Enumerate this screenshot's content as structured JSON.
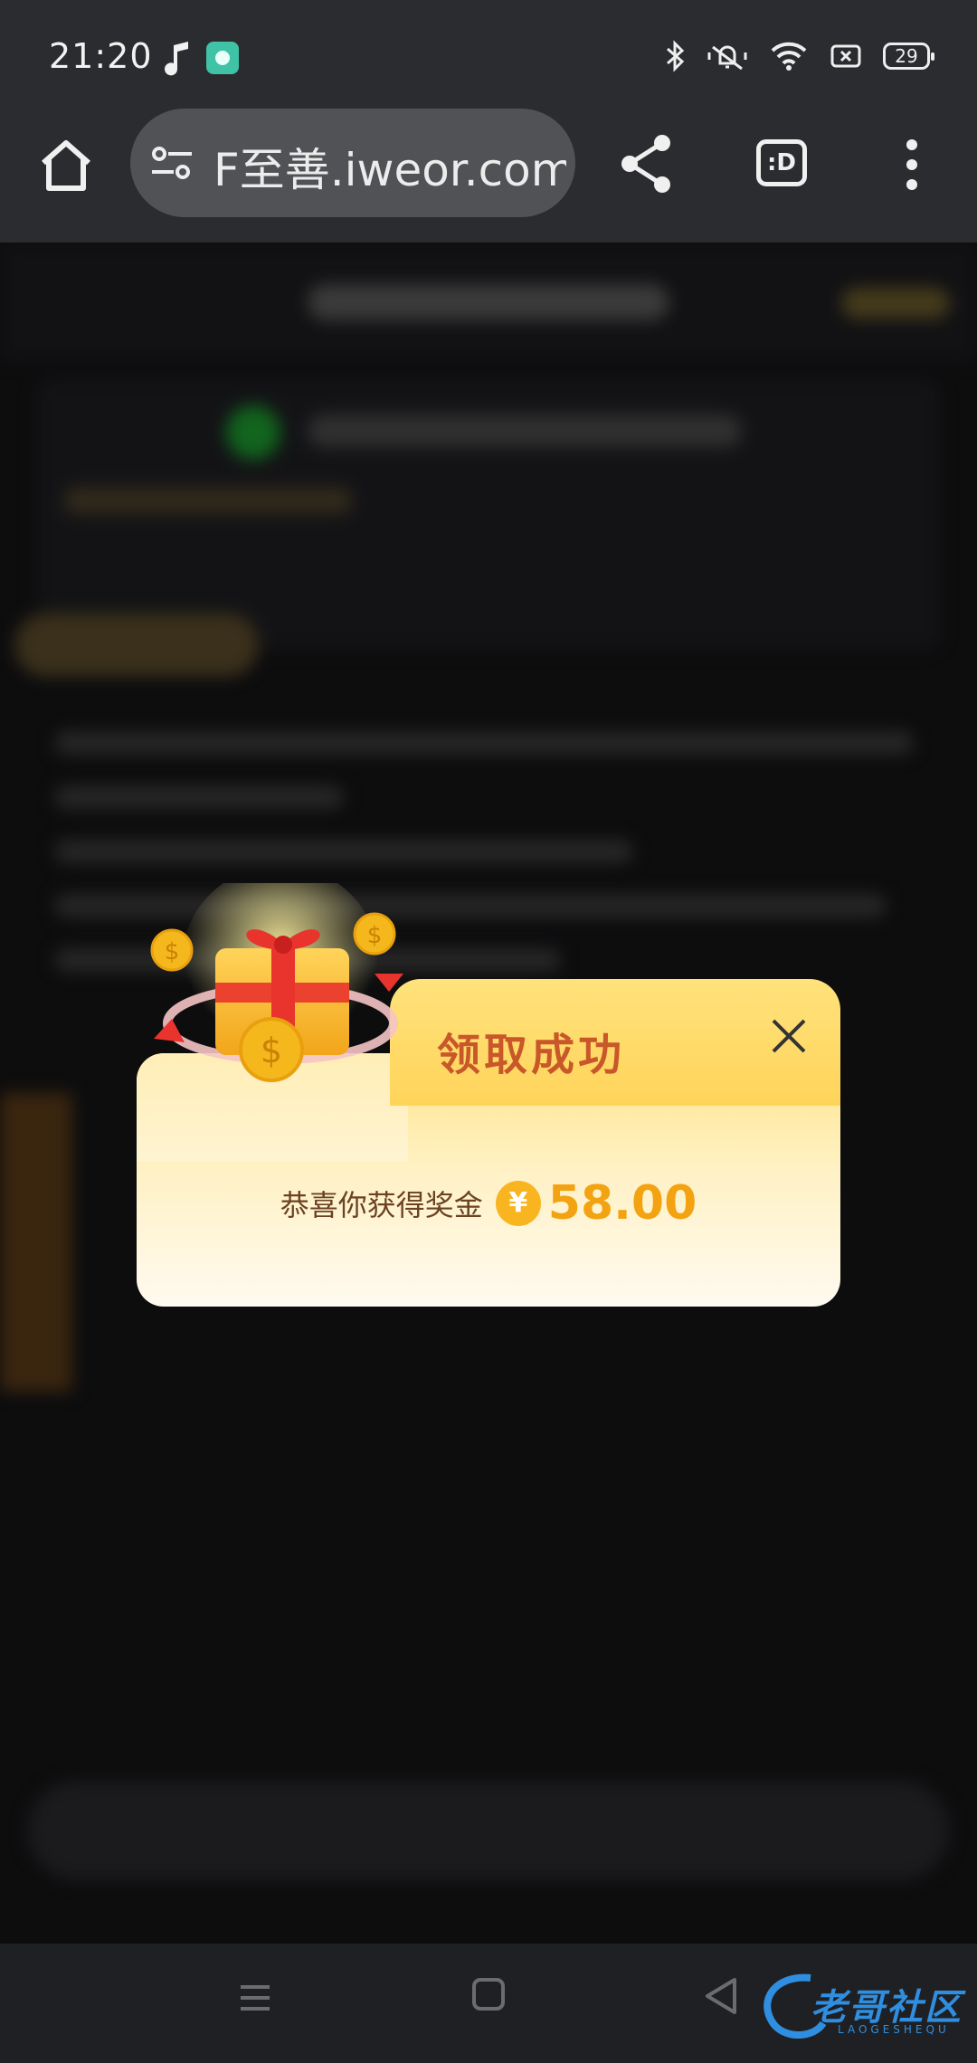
{
  "status_bar": {
    "time": "21:20",
    "battery": "29",
    "icons": [
      "music-note-icon",
      "app-notification-icon",
      "bluetooth-icon",
      "silent-mode-icon",
      "wifi-icon",
      "no-sim-icon",
      "battery-icon"
    ]
  },
  "browser": {
    "url": "F至善.iweor.com",
    "tabs_label": ":D",
    "icons": [
      "home-icon",
      "site-settings-icon",
      "share-icon",
      "tabs-icon",
      "more-vert-icon"
    ]
  },
  "popup": {
    "title": "领取成功",
    "reward_label": "恭喜你获得奖金",
    "currency_symbol": "¥",
    "amount": "58.00",
    "colors": {
      "title": "#c8582a",
      "amount": "#f3a312",
      "header": "#ffd45a"
    }
  },
  "watermark": {
    "text": "老哥社区",
    "subtext": "LAOGESHEQU"
  }
}
